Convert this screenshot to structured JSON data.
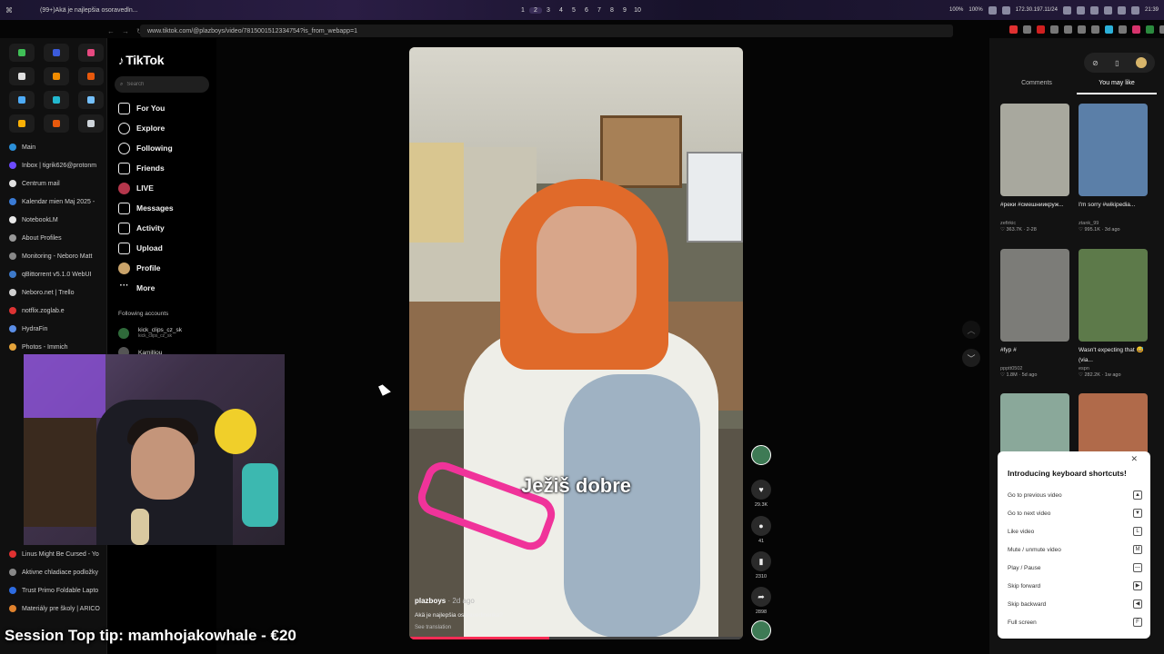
{
  "system_bar": {
    "window_title": "(99+)Akä je najlepšia osoravedln...",
    "workspaces": [
      "1",
      "2",
      "3",
      "4",
      "5",
      "6",
      "7",
      "8",
      "9",
      "10"
    ],
    "active_workspace": "2",
    "status": [
      "100%",
      "100%",
      "172.30.197.11/24",
      "21:39"
    ]
  },
  "browser": {
    "url": "www.tiktok.com/@plazboys/video/7815001512334754?is_from_webapp=1",
    "sidebar_tabs": [
      {
        "label": "Main",
        "color": "#2b8fd8"
      },
      {
        "label": "Inbox | tigrik626@protonm",
        "color": "#6d4aff"
      },
      {
        "label": "Centrum mail",
        "color": "#e0e0e0"
      },
      {
        "label": "Kalendar mien Maj 2025 -",
        "color": "#3a7bd5"
      },
      {
        "label": "NotebookLM",
        "color": "#e8e8e8"
      },
      {
        "label": "About Profiles",
        "color": "#999"
      },
      {
        "label": "Monitoring - Neboro Matt",
        "color": "#888"
      },
      {
        "label": "qBittorrent v5.1.0 WebUI",
        "color": "#3d79c9"
      },
      {
        "label": "Neboro.net | Trello",
        "color": "#cfcfcf"
      },
      {
        "label": "notflix.zoglab.e",
        "color": "#d33"
      },
      {
        "label": "HydraFin",
        "color": "#5b8ee6"
      },
      {
        "label": "Photos - Immich",
        "color": "#e5a33a"
      }
    ],
    "lower_tabs": [
      {
        "label": "Linus Might Be Cursed - Yo",
        "color": "#e03131"
      },
      {
        "label": "Aktivne chladiace podložky",
        "color": "#888"
      },
      {
        "label": "Trust Primo Foldable Lapto",
        "color": "#2d6be0"
      },
      {
        "label": "Materiály pre školy | ARICO",
        "color": "#e0822d"
      }
    ]
  },
  "tiktok": {
    "logo": "TikTok",
    "search_placeholder": "Search",
    "menu": [
      {
        "label": "For You",
        "icon": "home-icon"
      },
      {
        "label": "Explore",
        "icon": "compass-icon"
      },
      {
        "label": "Following",
        "icon": "following-icon"
      },
      {
        "label": "Friends",
        "icon": "friends-icon"
      },
      {
        "label": "LIVE",
        "icon": "live-icon"
      },
      {
        "label": "Messages",
        "icon": "messages-icon"
      },
      {
        "label": "Activity",
        "icon": "activity-icon"
      },
      {
        "label": "Upload",
        "icon": "upload-icon"
      },
      {
        "label": "Profile",
        "icon": "profile-icon"
      },
      {
        "label": "More",
        "icon": "more-icon"
      }
    ],
    "following_title": "Following accounts",
    "following": [
      {
        "name": "kick_clips_cz_sk",
        "handle": "kick_clips_cz_sk"
      },
      {
        "name": "Kamilliou",
        "handle": ""
      }
    ]
  },
  "video": {
    "subtitle": "Ježiš dobre",
    "author": "plazboys",
    "age": "2d ago",
    "description": "Akä je najlepšia osoravedinenka?",
    "translation": "See translation",
    "progress": 0.42
  },
  "actions": {
    "likes": "29.3K",
    "comments": "41",
    "saves": "2310",
    "shares": "2898"
  },
  "right_panel": {
    "tabs": [
      "Comments",
      "You may like"
    ],
    "active_tab": "You may like",
    "cards": [
      {
        "title": "#реки #смешниикруж...",
        "author": "zefirkic",
        "stats": "♡ 363.7K · 2-28",
        "color": "#a8a89e"
      },
      {
        "title": "I'm sorry #wikipedia...",
        "author": "ztank_99",
        "stats": "♡ 995.1K · 3d ago",
        "color": "#5b7fa8"
      },
      {
        "title": "#fyp #",
        "author": "ppptt0502",
        "stats": "♡ 1.8M · 5d ago",
        "color": "#7c7c78"
      },
      {
        "title": "Wasn't expecting that 😅 (via...",
        "author": "espn",
        "stats": "♡ 282.2K · 1w ago",
        "color": "#5d7a4a"
      },
      {
        "title": "",
        "author": "",
        "stats": "",
        "color": "#8aa89a"
      },
      {
        "title": "",
        "author": "",
        "stats": "",
        "color": "#b06a4a"
      }
    ]
  },
  "shortcuts": {
    "title": "Introducing keyboard shortcuts!",
    "items": [
      {
        "label": "Go to previous video",
        "key": "▲"
      },
      {
        "label": "Go to next video",
        "key": "▼"
      },
      {
        "label": "Like video",
        "key": "L"
      },
      {
        "label": "Mute / unmute video",
        "key": "M"
      },
      {
        "label": "Play / Pause",
        "key": "—"
      },
      {
        "label": "Skip forward",
        "key": "▶"
      },
      {
        "label": "Skip backward",
        "key": "◀"
      },
      {
        "label": "Full screen",
        "key": "F"
      }
    ]
  },
  "overlay": {
    "tip": "Session Top tip: mamhojakowhale - €20"
  }
}
